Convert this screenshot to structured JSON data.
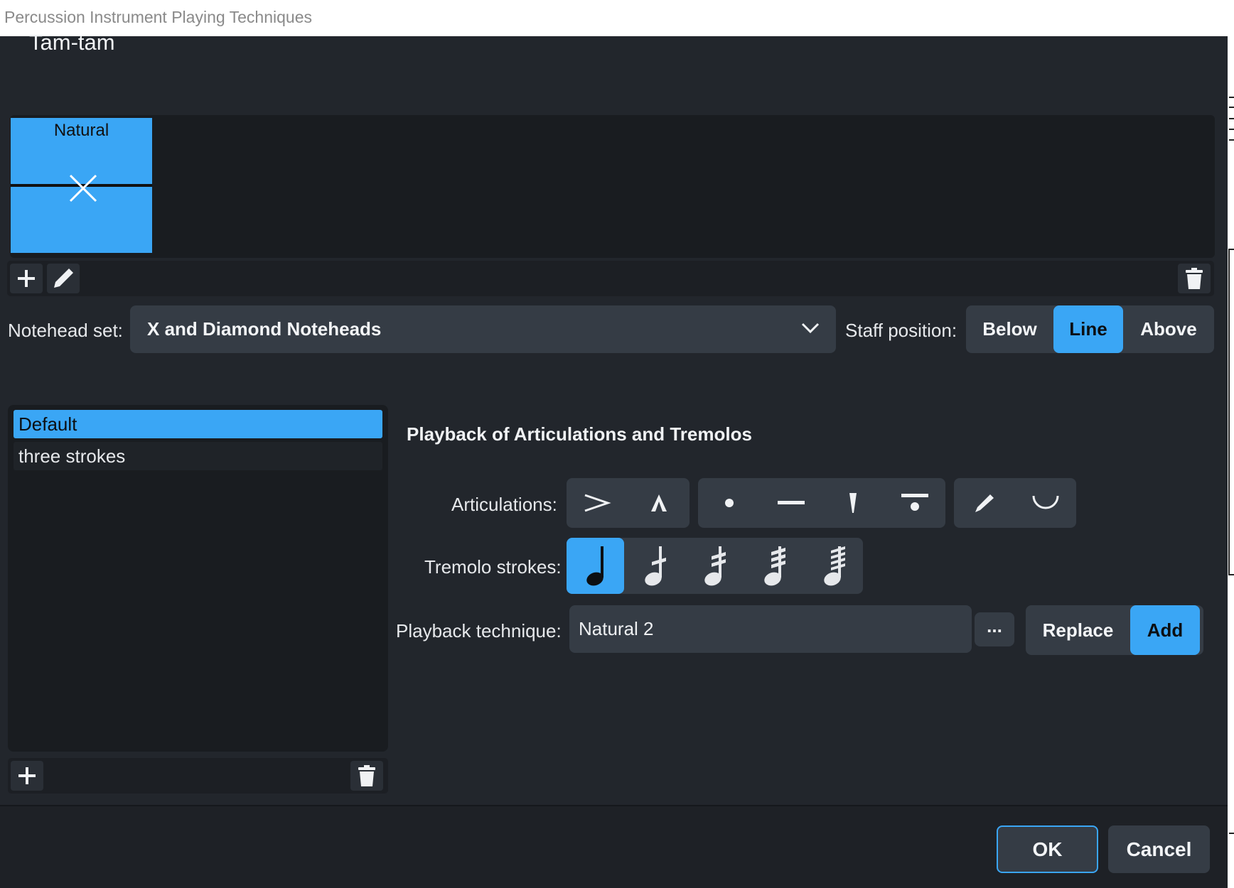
{
  "window": {
    "title": "Percussion Instrument Playing Techniques"
  },
  "instrument": {
    "name": "Tam-tam"
  },
  "techniques": [
    {
      "label": "Natural",
      "icon": "x-notehead-icon"
    }
  ],
  "technique_toolbar": {
    "add_icon": "plus-icon",
    "edit_icon": "pencil-icon",
    "delete_icon": "trash-icon"
  },
  "notehead": {
    "label": "Notehead set:",
    "value": "X and Diamond Noteheads"
  },
  "staff_position": {
    "label": "Staff position:",
    "options": [
      "Below",
      "Line",
      "Above"
    ],
    "selected": "Line"
  },
  "variations": {
    "items": [
      "Default",
      "three strokes"
    ],
    "selected": "Default"
  },
  "variation_toolbar": {
    "add_icon": "plus-icon",
    "delete_icon": "trash-icon"
  },
  "playback": {
    "section_title": "Playback of Articulations and Tremolos",
    "articulations_label": "Articulations:",
    "articulations": [
      "accent-icon",
      "marcato-icon",
      "staccato-icon",
      "tenuto-icon",
      "staccatissimo-icon",
      "tenuto-staccato-icon",
      "stress-icon",
      "unstress-icon"
    ],
    "tremolo_label": "Tremolo strokes:",
    "tremolos": [
      "no-tremolo-note-icon",
      "tremolo-1-stroke-icon",
      "tremolo-2-strokes-icon",
      "tremolo-3-strokes-icon",
      "tremolo-4-strokes-icon"
    ],
    "tremolo_selected": "no-tremolo-note-icon",
    "technique_label": "Playback technique:",
    "technique_value": "Natural 2",
    "dots_label": "...",
    "mode_options": [
      "Replace",
      "Add"
    ],
    "mode_selected": "Add"
  },
  "footer": {
    "ok_label": "OK",
    "cancel_label": "Cancel"
  },
  "colors": {
    "accent": "#3aa6f5",
    "background": "#22262c",
    "control": "#353c45"
  }
}
